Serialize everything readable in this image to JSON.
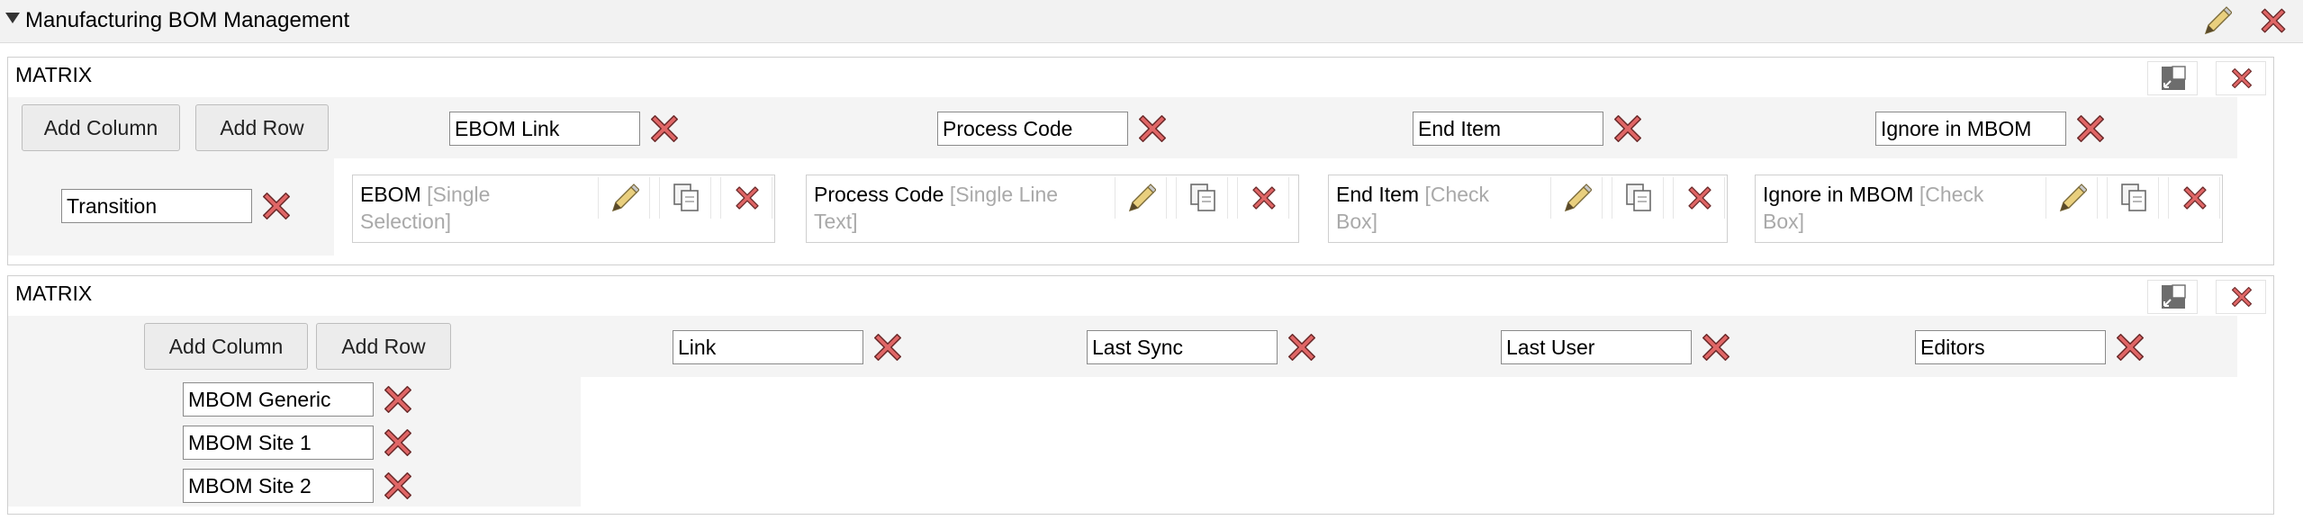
{
  "header": {
    "title": "Manufacturing BOM Management"
  },
  "matrix1": {
    "title": "MATRIX",
    "add_column": "Add Column",
    "add_row": "Add Row",
    "columns": [
      "EBOM Link",
      "Process Code",
      "End Item",
      "Ignore in MBOM"
    ],
    "rows": [
      "Transition"
    ],
    "cells": [
      {
        "name": "EBOM",
        "type": "[Single Selection]"
      },
      {
        "name": "Process Code",
        "type": "[Single Line Text]"
      },
      {
        "name": "End Item",
        "type": "[Check Box]"
      },
      {
        "name": "Ignore in MBOM",
        "type": "[Check Box]"
      }
    ]
  },
  "matrix2": {
    "title": "MATRIX",
    "add_column": "Add Column",
    "add_row": "Add Row",
    "columns": [
      "Link",
      "Last Sync",
      "Last User",
      "Editors"
    ],
    "rows": [
      "MBOM Generic",
      "MBOM Site 1",
      "MBOM Site 2"
    ]
  },
  "icons": {
    "pencil": "pencil-icon",
    "copy": "copy-icon",
    "delete": "delete-x-icon",
    "resize": "resize-icon",
    "collapse": "caret-down-icon"
  },
  "colors": {
    "delete_red": "#d9534f",
    "band_bg": "#f4f4f4",
    "header_bg": "#f2f2f2"
  }
}
